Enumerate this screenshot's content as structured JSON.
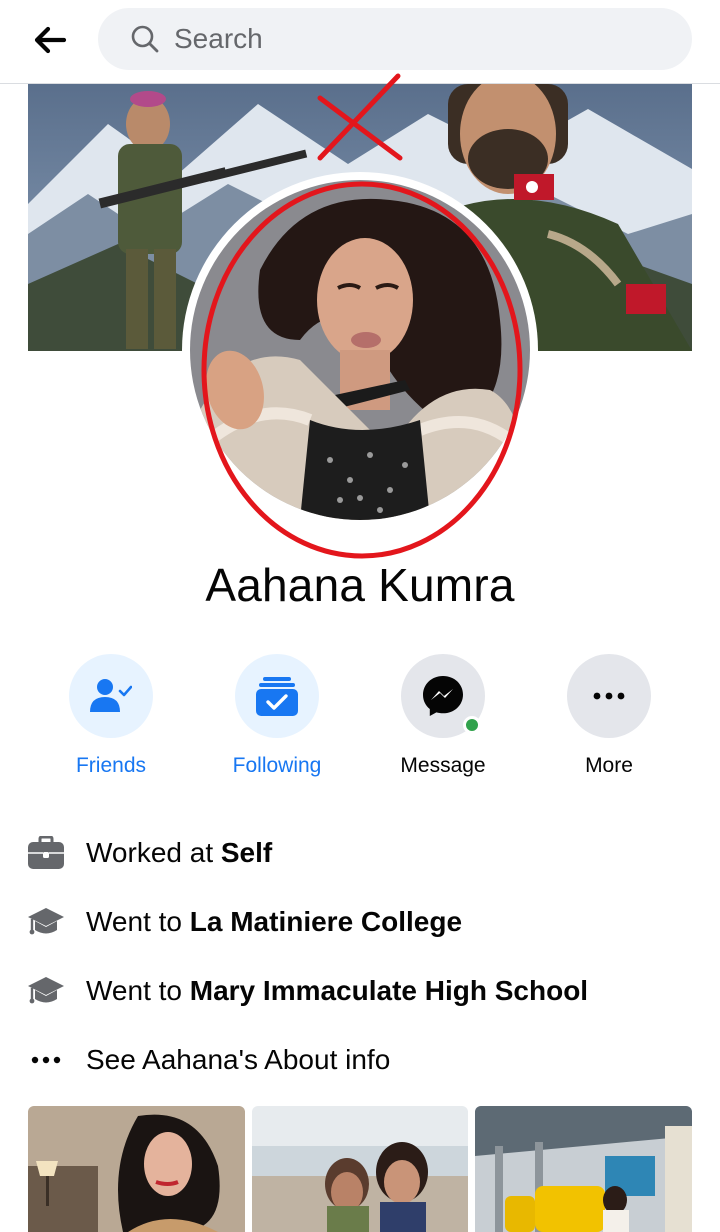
{
  "header": {
    "search_placeholder": "Search"
  },
  "profile": {
    "name": "Aahana Kumra"
  },
  "actions": [
    {
      "label": "Friends",
      "icon": "friends-icon"
    },
    {
      "label": "Following",
      "icon": "following-icon"
    },
    {
      "label": "Message",
      "icon": "messenger-icon"
    },
    {
      "label": "More",
      "icon": "more-dots-icon"
    }
  ],
  "info": [
    {
      "prefix": "Worked at ",
      "bold": "Self",
      "icon": "briefcase-icon"
    },
    {
      "prefix": "Went to ",
      "bold": "La Matiniere College",
      "icon": "graduation-cap-icon"
    },
    {
      "prefix": "Went to ",
      "bold": "Mary Immaculate High School",
      "icon": "graduation-cap-icon"
    },
    {
      "prefix": "See Aahana's About info",
      "bold": "",
      "icon": "more-dots-icon"
    }
  ],
  "colors": {
    "accent": "#1877f2",
    "accent_bg": "#e7f3ff",
    "online": "#31a24c",
    "annotation_red": "#e3161c"
  }
}
